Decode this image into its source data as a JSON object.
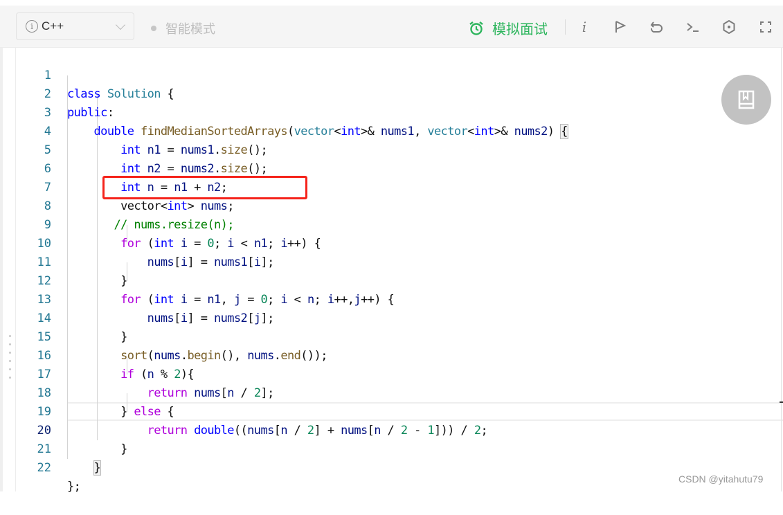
{
  "toolbar": {
    "language": "C++",
    "language_icon": "info-circle-icon",
    "smart_mode_label": "智能模式",
    "mock_interview_label": "模拟面试",
    "mock_interview_icon": "alarm-clock-icon",
    "icons": [
      "info-icon",
      "flag-icon",
      "undo-icon",
      "terminal-icon",
      "settings-icon",
      "fullscreen-icon"
    ],
    "accent_color": "#2db55d"
  },
  "editor": {
    "current_line": 20,
    "highlighted_line": 8,
    "lines": [
      {
        "no": "1",
        "text": "class Solution {"
      },
      {
        "no": "2",
        "text": "public:"
      },
      {
        "no": "3",
        "text": "    double findMedianSortedArrays(vector<int>& nums1, vector<int>& nums2) {"
      },
      {
        "no": "4",
        "text": "        int n1 = nums1.size();"
      },
      {
        "no": "5",
        "text": "        int n2 = nums2.size();"
      },
      {
        "no": "6",
        "text": "        int n = n1 + n2;"
      },
      {
        "no": "7",
        "text": "        vector<int> nums;"
      },
      {
        "no": "8",
        "text": "       // nums.resize(n);"
      },
      {
        "no": "9",
        "text": "        for (int i = 0; i < n1; i++) {"
      },
      {
        "no": "10",
        "text": "            nums[i] = nums1[i];"
      },
      {
        "no": "11",
        "text": "        }"
      },
      {
        "no": "12",
        "text": "        for (int i = n1, j = 0; i < n; i++,j++) {"
      },
      {
        "no": "13",
        "text": "            nums[i] = nums2[j];"
      },
      {
        "no": "14",
        "text": "        }"
      },
      {
        "no": "15",
        "text": "        sort(nums.begin(), nums.end());"
      },
      {
        "no": "16",
        "text": "        if (n % 2){"
      },
      {
        "no": "17",
        "text": "            return nums[n / 2];"
      },
      {
        "no": "18",
        "text": "        } else {"
      },
      {
        "no": "19",
        "text": "            return double((nums[n / 2] + nums[n / 2 - 1])) / 2;"
      },
      {
        "no": "20",
        "text": "        }"
      },
      {
        "no": "21",
        "text": "    }"
      },
      {
        "no": "22",
        "text": "};"
      }
    ]
  },
  "fab_icon": "book-icon",
  "watermark": "CSDN @yitahutu79"
}
